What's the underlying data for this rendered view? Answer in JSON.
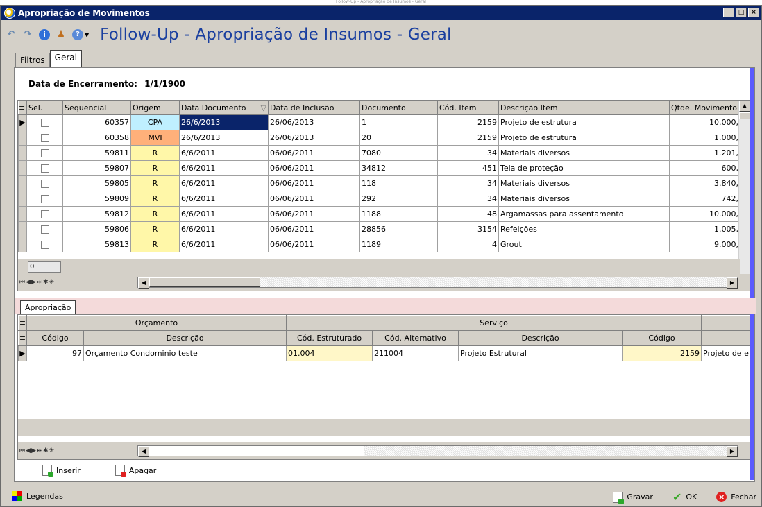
{
  "window": {
    "title": "Apropriação de Movimentos",
    "caption_top": "Follow-Up - Apropriação de Insumos - Geral"
  },
  "heading": "Follow-Up - Apropriação de Insumos - Geral",
  "tabs": [
    {
      "label": "Filtros"
    },
    {
      "label": "Geral"
    }
  ],
  "encerramento": {
    "label": "Data de Encerramento:",
    "value": "1/1/1900"
  },
  "grid1": {
    "columns": [
      "Sel.",
      "Sequencial",
      "Origem",
      "Data Documento",
      "Data de Inclusão",
      "Documento",
      "Cód. Item",
      "Descrição Item",
      "Qtde. Movimento"
    ],
    "rows": [
      [
        "60357",
        "CPA",
        "26/6/2013",
        "26/06/2013",
        "1",
        "2159",
        "Projeto de estrutura",
        "10.000,"
      ],
      [
        "60358",
        "MVI",
        "26/6/2013",
        "26/06/2013",
        "20",
        "2159",
        "Projeto de estrutura",
        "1.000,"
      ],
      [
        "59811",
        "R",
        "6/6/2011",
        "06/06/2011",
        "7080",
        "34",
        "Materiais diversos",
        "1.201,"
      ],
      [
        "59807",
        "R",
        "6/6/2011",
        "06/06/2011",
        "34812",
        "451",
        "Tela de proteção",
        "600,"
      ],
      [
        "59805",
        "R",
        "6/6/2011",
        "06/06/2011",
        "118",
        "34",
        "Materiais diversos",
        "3.840,"
      ],
      [
        "59809",
        "R",
        "6/6/2011",
        "06/06/2011",
        "292",
        "34",
        "Materiais diversos",
        "742,"
      ],
      [
        "59812",
        "R",
        "6/6/2011",
        "06/06/2011",
        "1188",
        "48",
        "Argamassas para assentamento",
        "10.000,"
      ],
      [
        "59806",
        "R",
        "6/6/2011",
        "06/06/2011",
        "28856",
        "3154",
        "Refeições",
        "1.005,"
      ],
      [
        "59813",
        "R",
        "6/6/2011",
        "06/06/2011",
        "1189",
        "4",
        "Grout",
        "9.000,"
      ]
    ],
    "count": "0"
  },
  "tab2": "Apropriação",
  "grid2": {
    "group_headers": [
      "Orçamento",
      "Serviço"
    ],
    "columns": [
      "Código",
      "Descrição",
      "Cód. Estruturado",
      "Cód. Alternativo",
      "Descrição",
      "Código"
    ],
    "row": [
      "97",
      "Orçamento Condominio teste",
      "01.004",
      "211004",
      "Projeto Estrutural",
      "2159",
      "Projeto de e"
    ]
  },
  "actions": {
    "inserir": "Inserir",
    "apagar": "Apagar"
  },
  "status": {
    "legendas": "Legendas",
    "gravar": "Gravar",
    "ok": "OK",
    "fechar": "Fechar"
  }
}
